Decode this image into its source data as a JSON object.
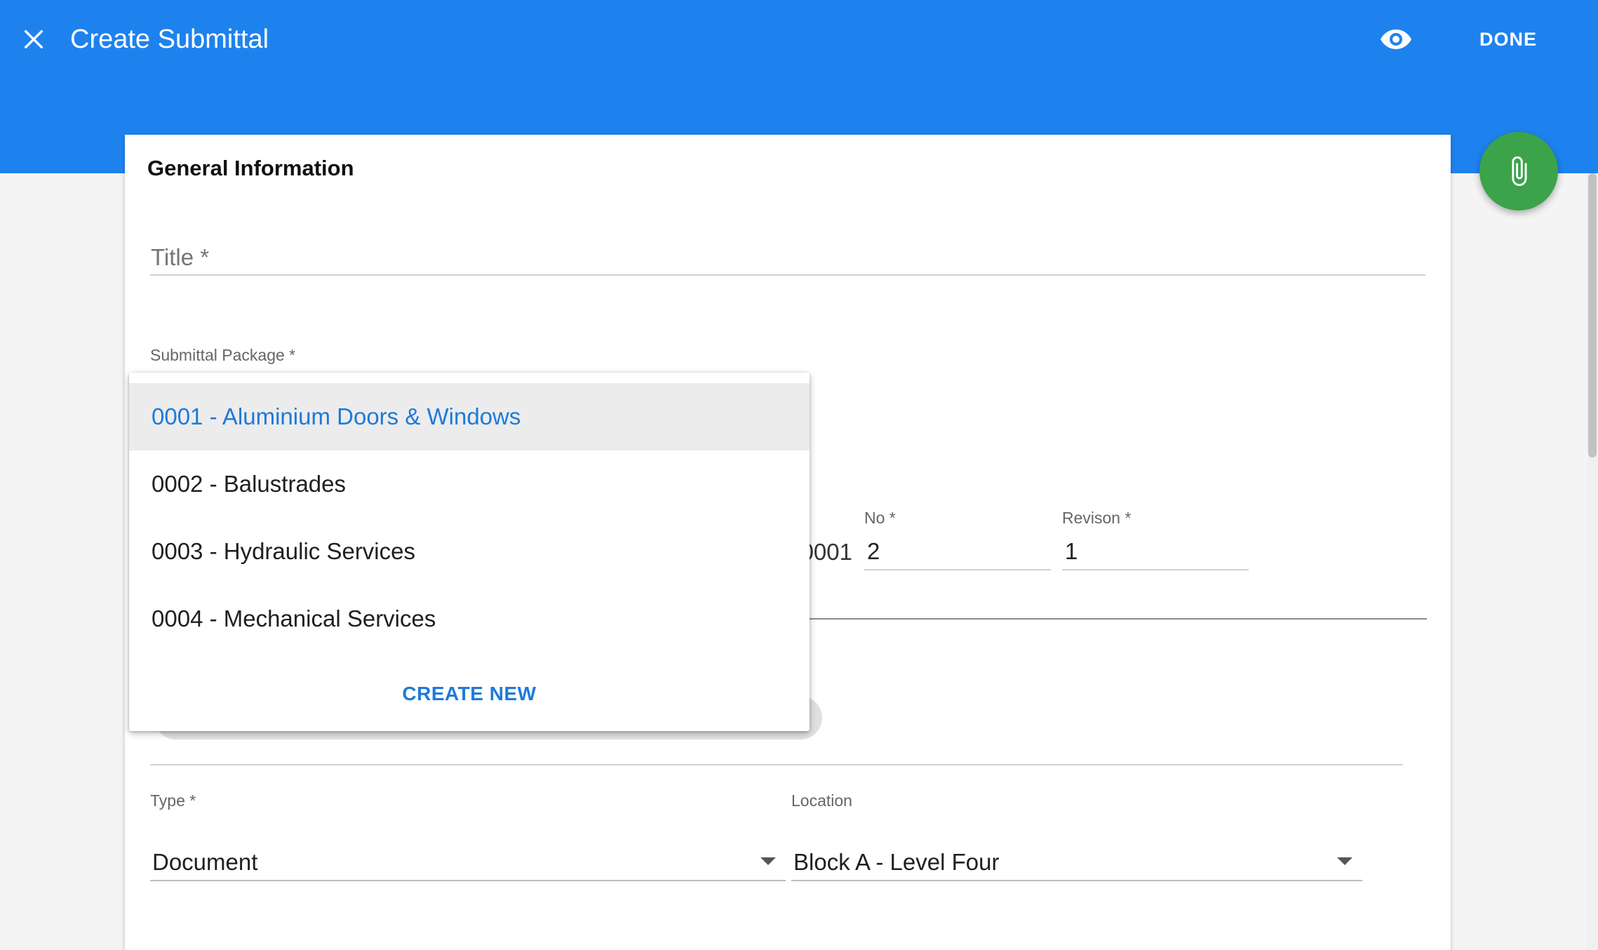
{
  "appbar": {
    "title": "Create Submittal",
    "done_label": "DONE",
    "close_icon": "close-icon",
    "preview_icon": "eye-icon",
    "background_color": "#1e82ee"
  },
  "form": {
    "section_title": "General Information",
    "title_field": {
      "label": "Title *",
      "value": ""
    },
    "package_field": {
      "label": "Submittal Package *"
    },
    "number": {
      "prefix": "0001 -",
      "no_label": "No *",
      "no_value": "2",
      "revision_label": "Revison *",
      "revision_value": "1"
    },
    "type_field": {
      "label": "Type *",
      "value": "Document"
    },
    "location_field": {
      "label": "Location",
      "value": "Block A - Level Four"
    }
  },
  "package_menu": {
    "items": [
      {
        "label": "0001 - Aluminium Doors & Windows",
        "selected": true
      },
      {
        "label": "0002 - Balustrades",
        "selected": false
      },
      {
        "label": "0003 - Hydraulic Services",
        "selected": false
      },
      {
        "label": "0004 - Mechanical Services",
        "selected": false
      }
    ],
    "create_new_label": "CREATE NEW",
    "accent_color": "#1e7ad8"
  },
  "fab": {
    "icon": "paperclip-icon",
    "color": "#3ba34a"
  }
}
